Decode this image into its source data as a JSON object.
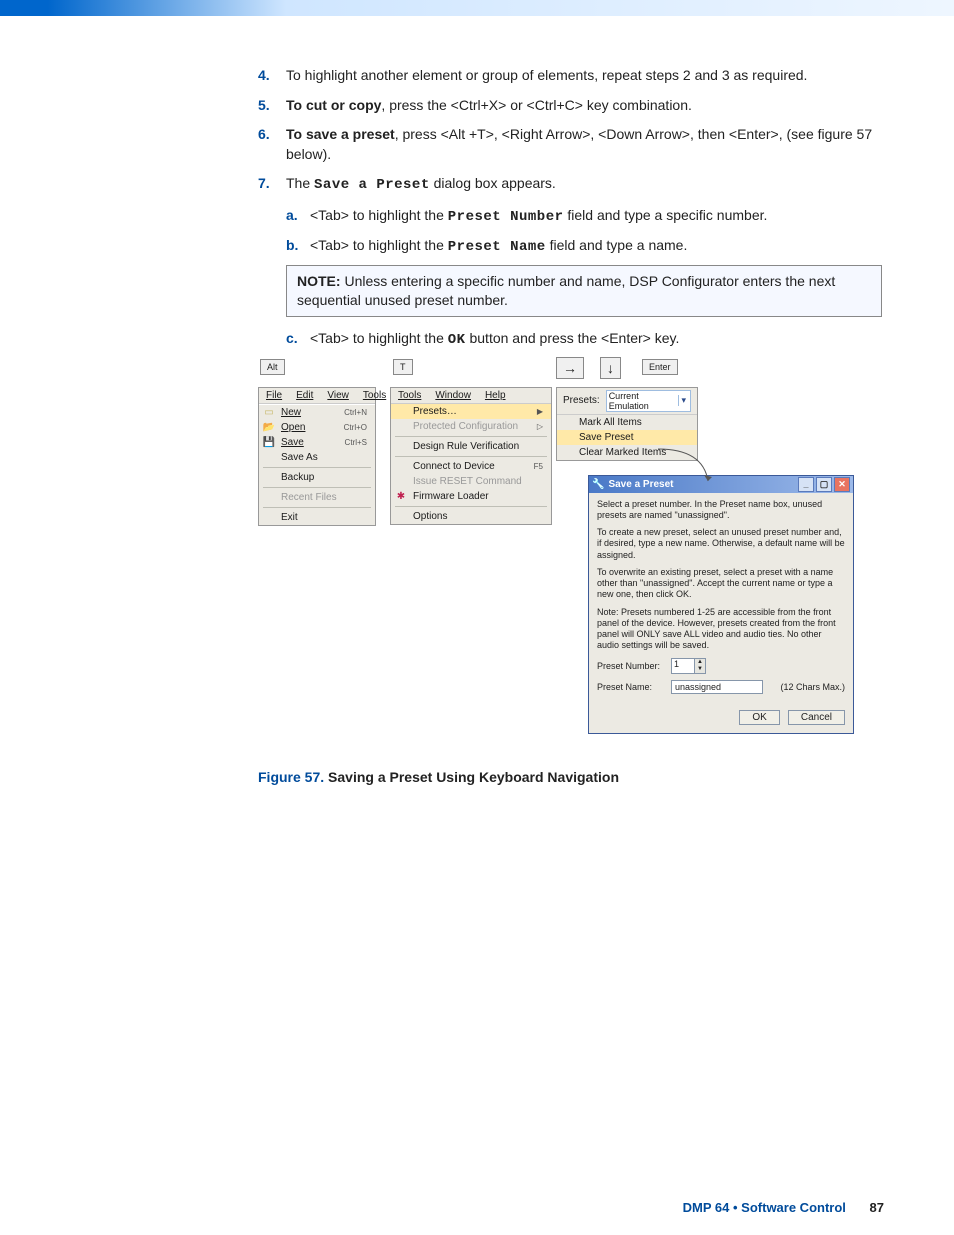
{
  "steps": {
    "s4": {
      "n": "4.",
      "body": "To highlight another element or group of elements, repeat steps 2 and 3 as required."
    },
    "s5": {
      "n": "5.",
      "lead": "To cut or copy",
      "body": ", press the <Ctrl+X> or <Ctrl+C> key combination."
    },
    "s6": {
      "n": "6.",
      "lead": "To save a preset",
      "body": ", press <Alt +T>, <Right Arrow>, <Down Arrow>, then <Enter>, (see figure 57 below)."
    },
    "s7": {
      "n": "7.",
      "pre": "The ",
      "mono": "Save a Preset",
      "post": " dialog box appears."
    }
  },
  "sub": {
    "a": {
      "n": "a.",
      "pre": "<Tab> to highlight the ",
      "mono": "Preset Number",
      "post": " field and type a specific number."
    },
    "b": {
      "n": "b.",
      "pre": "<Tab> to highlight the ",
      "mono": "Preset Name",
      "post": " field and type a name."
    },
    "c": {
      "n": "c.",
      "pre": "<Tab> to highlight the ",
      "mono": "OK",
      "post": " button and press the <Enter> key."
    }
  },
  "note": {
    "label": "NOTE:",
    "text": "  Unless entering a specific number and name, DSP Configurator enters the next sequential unused preset number."
  },
  "keys": {
    "alt": "Alt",
    "t": "T",
    "enter": "Enter",
    "right": "→",
    "down": "↓"
  },
  "file_menu": {
    "bar": [
      "File",
      "Edit",
      "View",
      "Tools"
    ],
    "items": [
      {
        "label": "New",
        "sc": "Ctrl+N",
        "icon": "new"
      },
      {
        "label": "Open",
        "sc": "Ctrl+O",
        "icon": "open"
      },
      {
        "label": "Save",
        "sc": "Ctrl+S",
        "icon": "save"
      },
      {
        "label": "Save As",
        "sc": ""
      },
      {
        "label": "Backup",
        "sc": "",
        "sep_before": true
      },
      {
        "label": "Recent Files",
        "sc": "",
        "disabled": true,
        "sep_before": true
      },
      {
        "label": "Exit",
        "sc": "",
        "sep_before": true
      }
    ]
  },
  "tools_menu": {
    "bar": [
      "Tools",
      "Window",
      "Help"
    ],
    "items": [
      {
        "label": "Presets…",
        "sub": true,
        "hl": true
      },
      {
        "label": "Protected Configuration",
        "sub": true,
        "disabled": true
      },
      {
        "label": "Design Rule Verification",
        "sep_before": true
      },
      {
        "label": "Connect to Device",
        "sc": "F5",
        "sep_before": true
      },
      {
        "label": "Issue RESET Command",
        "disabled": true
      },
      {
        "label": "Firmware Loader",
        "icon": "fw"
      },
      {
        "label": "Options",
        "sep_before": true
      }
    ]
  },
  "presets_panel": {
    "label": "Presets:",
    "combo": "Current Emulation",
    "items": [
      {
        "label": "Mark All Items"
      },
      {
        "label": "Save Preset",
        "hl": true
      },
      {
        "label": "Clear Marked Items"
      }
    ]
  },
  "dialog": {
    "title": "Save a Preset",
    "p1": "Select a preset number.  In the Preset name box, unused presets are named \"unassigned\".",
    "p2": "To create a new preset, select an unused preset number and, if desired, type a new name.  Otherwise, a default name will be assigned.",
    "p3": "To overwrite an existing preset, select a preset with a name other than \"unassigned\".  Accept the current name or type a new one, then click OK.",
    "p4": "Note: Presets numbered 1-25 are accessible from the front panel of the device.  However, presets created from the front panel will ONLY save ALL video and audio ties.  No other audio settings will be saved.",
    "num_label": "Preset Number:",
    "num_value": "1",
    "name_label": "Preset Name:",
    "name_value": "unassigned",
    "chars": "(12 Chars Max.)",
    "ok": "OK",
    "cancel": "Cancel"
  },
  "figcap": {
    "fig": "Figure 57.",
    "text": "  Saving a Preset Using Keyboard Navigation"
  },
  "footer": {
    "section": "DMP 64 • Software Control",
    "page": "87"
  }
}
